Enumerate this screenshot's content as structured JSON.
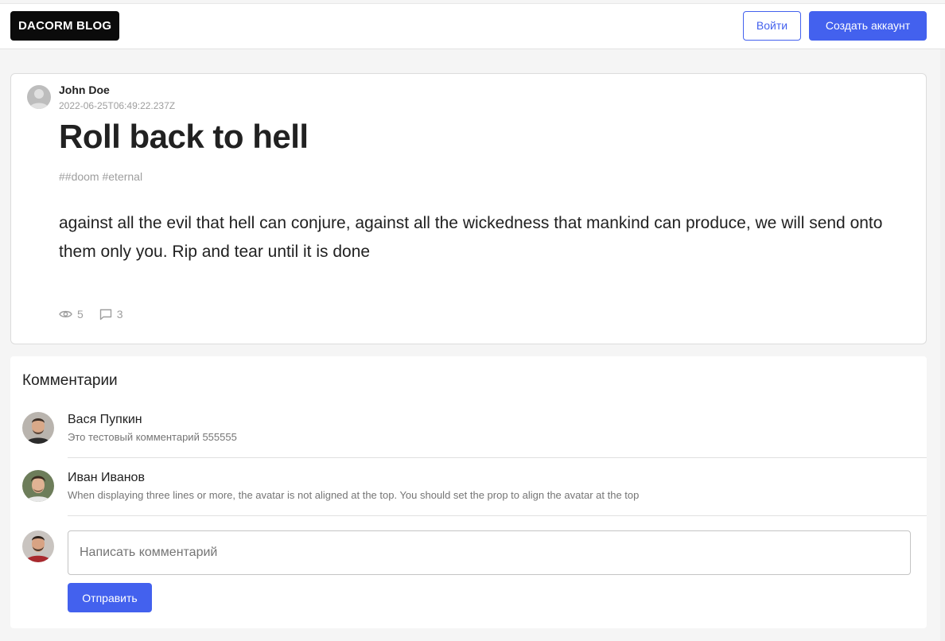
{
  "header": {
    "logo": "DACORM BLOG",
    "login_label": "Войти",
    "register_label": "Создать аккаунт"
  },
  "post": {
    "author": "John Doe",
    "date": "2022-06-25T06:49:22.237Z",
    "title": "Roll back to hell",
    "tags": "##doom #eternal",
    "body": "against all the evil that hell can conjure, against all the wickedness that mankind can produce, we will send onto them only you. Rip and tear until it is done",
    "views": "5",
    "comments_count": "3"
  },
  "comments": {
    "title": "Комментарии",
    "items": [
      {
        "name": "Вася Пупкин",
        "text": "Это тестовый комментарий 555555"
      },
      {
        "name": "Иван Иванов",
        "text": "When displaying three lines or more, the avatar is not aligned at the top. You should set the prop to align the avatar at the top"
      }
    ],
    "input_placeholder": "Написать комментарий",
    "send_label": "Отправить"
  },
  "colors": {
    "accent": "#4361ee",
    "logo_bg": "#0b0b0b",
    "page_bg": "#f5f5f5"
  }
}
